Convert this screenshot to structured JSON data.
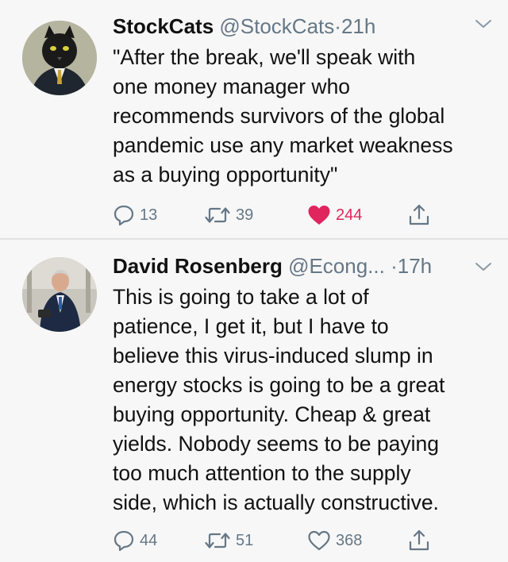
{
  "colors": {
    "like_active": "#e0245e",
    "muted": "#657786",
    "text": "#111111",
    "background": "#f7f7f7"
  },
  "tweets": [
    {
      "name": "StockCats",
      "handle": "@StockCats",
      "dot": "·",
      "time": "21h",
      "lines": [
        "\"After the break, we'll speak with",
        "one money manager who",
        "recommends survivors of the global",
        "pandemic use any market weakness",
        "as a buying opportunity\""
      ],
      "replies": "13",
      "retweets": "39",
      "likes": "244",
      "liked": true,
      "avatar_icon": "cat-in-suit-avatar"
    },
    {
      "name": "David Rosenberg",
      "handle": "@Econg...",
      "dot": "·",
      "time": "17h",
      "lines": [
        "This is going to take a lot of",
        "patience, I get it, but I have to",
        "believe this virus-induced slump in",
        "energy stocks is going to be a great",
        "buying opportunity. Cheap & great",
        "yields. Nobody seems to be paying",
        "too much attention to the supply",
        "side, which is actually constructive."
      ],
      "replies": "44",
      "retweets": "51",
      "likes": "368",
      "liked": false,
      "avatar_icon": "man-in-suit-avatar"
    }
  ]
}
